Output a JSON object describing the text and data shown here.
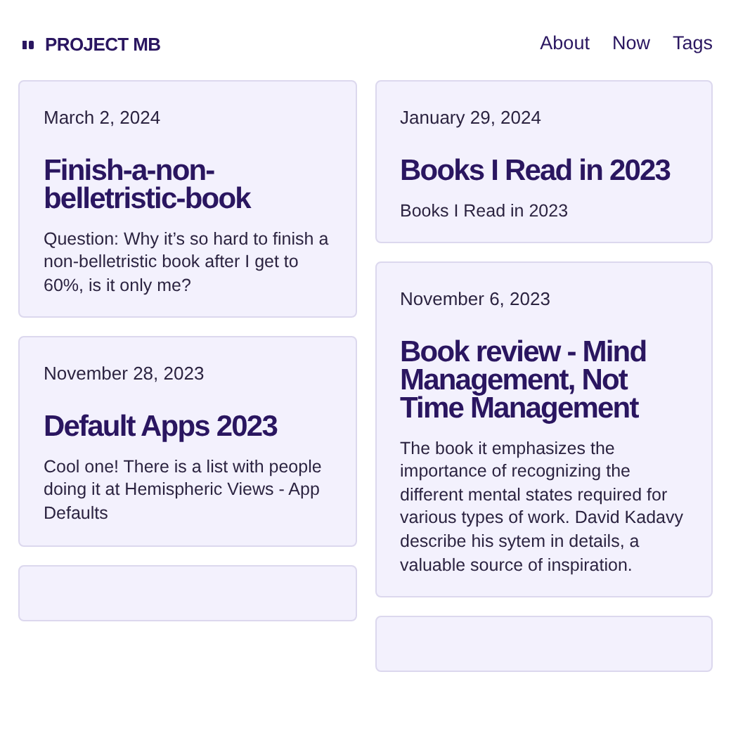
{
  "site": {
    "title": "PROJECT MB",
    "nav": [
      "About",
      "Now",
      "Tags"
    ]
  },
  "columns": [
    {
      "posts": [
        {
          "kind": "post",
          "date": "March 2, 2024",
          "title": "Finish-a-non-belletristic-book",
          "summary": "Question: Why it’s so hard to finish a non-belletristic book after I get to 60%, is it only me?"
        },
        {
          "kind": "post",
          "date": "November 28, 2023",
          "title": "Default Apps 2023",
          "summary": "Cool one! There is a list with people doing it at Hemispheric Views - App Defaults"
        },
        {
          "kind": "cut"
        }
      ]
    },
    {
      "posts": [
        {
          "kind": "post",
          "date": "January 29, 2024",
          "title": "Books I Read in 2023",
          "summary": "Books I Read in 2023"
        },
        {
          "kind": "post",
          "date": "November 6, 2023",
          "title": "Book review - Mind Management, Not Time Management",
          "summary": "The book it emphasizes the importance of recognizing the different mental states required for various types of work. David Kadavy describe his sytem in details, a valuable source of inspiration."
        },
        {
          "kind": "cut"
        }
      ]
    }
  ]
}
